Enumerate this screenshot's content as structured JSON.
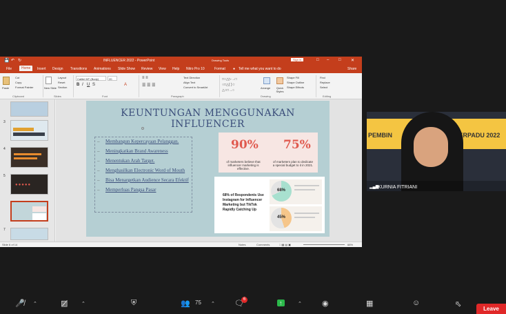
{
  "ppt": {
    "title": "INFLUENCER 2022  -  PowerPoint",
    "drawing_tools": "Drawing Tools",
    "signin": "Sign in",
    "share": "Share",
    "tell_me": "Tell me what you want to do",
    "tabs": [
      "File",
      "Home",
      "Insert",
      "Design",
      "Transitions",
      "Animations",
      "Slide Show",
      "Review",
      "View",
      "Help",
      "Nitro Pro 10",
      "Format"
    ],
    "ribbon": {
      "paste": "Paste",
      "cut": "Cut",
      "copy": "Copy",
      "format_painter": "Format Painter",
      "clipboard": "Clipboard",
      "new_slide": "New Slide",
      "layout": "Layout",
      "reset": "Reset",
      "section": "Section",
      "slides": "Slides",
      "font_name": "Calibri MT (Body)",
      "font_size": "20",
      "font": "Font",
      "paragraph": "Paragraph",
      "text_direction": "Text Direction",
      "align_text": "Align Text",
      "convert_smartart": "Convert to SmartArt",
      "arrange": "Arrange",
      "quick_styles": "Quick Styles",
      "shape_fill": "Shape Fill",
      "shape_outline": "Shape Outline",
      "shape_effects": "Shape Effects",
      "drawing": "Drawing",
      "find": "Find",
      "replace": "Replace",
      "select": "Select",
      "editing": "Editing"
    },
    "thumb_numbers": [
      "3",
      "4",
      "5",
      "6",
      "7"
    ],
    "status": {
      "slide_of": "Slide 6 of 14",
      "notes": "Notes",
      "comments": "Comments",
      "zoom": "68%"
    }
  },
  "slide": {
    "title_line1": "KEUNTUNGAN MENGGUNAKAN",
    "title_line2": "INFLUENCER",
    "bullets": [
      "Membangun Kepercayaan Pelanggan.",
      "Meningkatkan Brand Awareness",
      "Menentukan Arah Target.",
      "Menghasilkan Electronic Word of Mouth",
      "Bisa Menargetkan Audience Secara Efektif",
      "Memperluas Pangsa Pasar"
    ],
    "stat1_value": "90%",
    "stat1_caption": "of marketers believe that influencer marketing is effective.",
    "stat2_value": "75%",
    "stat2_caption": "of marketers plan to dedicate a special budget to it in 2021.",
    "card2_text": "68% of Respondents Use Instagram for Influencer Marketing but TikTok Rapidly Catching Up",
    "pie1_label": "68%",
    "pie2_label": "45%"
  },
  "webcam": {
    "name": "KURNIA FITRIANI",
    "banner_left": "PEMBIN",
    "banner_right": "TERPADU 2022"
  },
  "toolbar": {
    "participants": "75",
    "chat_badge": "6",
    "leave": "Leave"
  },
  "colors": {
    "ppt_red": "#c43e1c",
    "slide_bg": "#b5cfd3",
    "accent_coral": "#e05a4f",
    "leave_red": "#e02828"
  }
}
